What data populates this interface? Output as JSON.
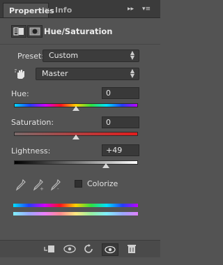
{
  "tabs": [
    {
      "label": "Properties",
      "close": "×"
    },
    {
      "label": "Info"
    }
  ],
  "tabbar_controls": {
    "collapse": "▸▸",
    "menu": "▾≡"
  },
  "header": {
    "title": "Hue/Saturation",
    "icons": [
      "adjustment-layer-icon",
      "layer-mask-icon"
    ]
  },
  "preset": {
    "label": "Preset:",
    "value": "Custom"
  },
  "channel": {
    "value": "Master",
    "icon": "hand-adjust-icon"
  },
  "hue": {
    "label": "Hue:",
    "value": "0",
    "slider_level": 0.5
  },
  "saturation": {
    "label": "Saturation:",
    "value": "0",
    "slider_level": 0.5
  },
  "lightness": {
    "label": "Lightness:",
    "value": "+49",
    "slider_level": 0.745
  },
  "eyedroppers": [
    "eyedropper-icon",
    "eyedropper-plus-icon",
    "eyedropper-minus-icon"
  ],
  "colorize": {
    "label": "Colorize",
    "checked": false
  },
  "footer_icons": [
    "clip-to-layer-icon",
    "view-previous-state-icon",
    "reset-icon",
    "visibility-eye-icon",
    "trash-icon"
  ],
  "colors": {
    "panel": "#535353",
    "field": "#3c3c3c",
    "tabbar": "#3b3b3b"
  }
}
